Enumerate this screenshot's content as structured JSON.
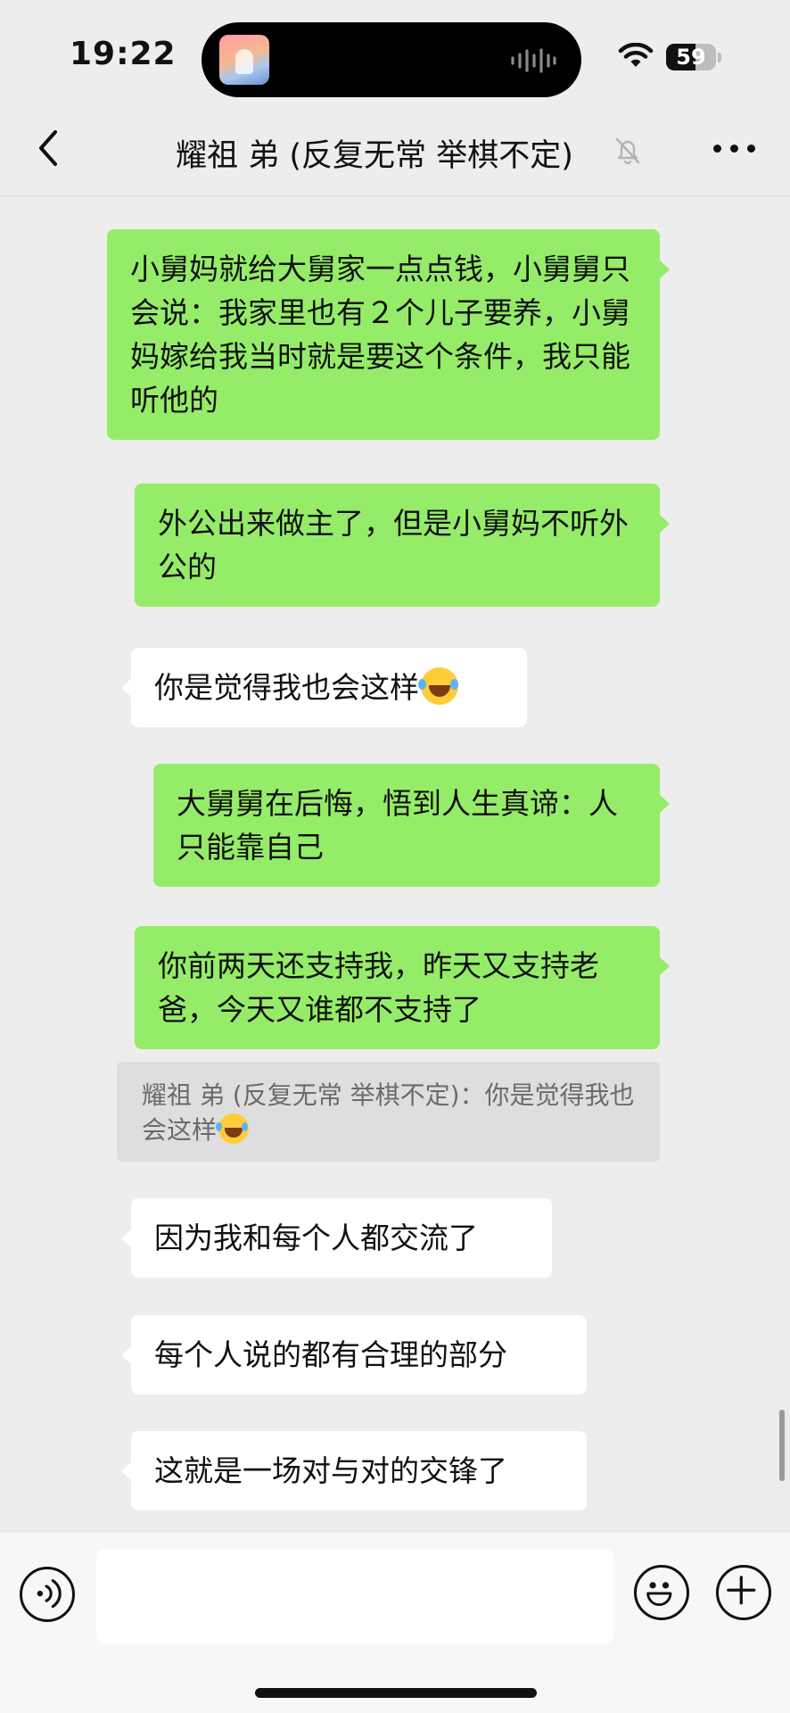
{
  "status_bar": {
    "time": "19:22",
    "battery_level": "59",
    "battery_fraction": 0.59,
    "island_art": "album-artwork",
    "island_activity": "audio-waveform-icon",
    "wifi": "wifi-icon"
  },
  "nav": {
    "title": "耀祖 弟 (反复无常 举棋不定)",
    "back_icon": "chevron-left-icon",
    "mute_icon": "bell-slash-icon",
    "more_icon": "more-dots-icon"
  },
  "messages": [
    {
      "sender": "me",
      "text": "小舅妈就给大舅家一点点钱，小舅舅只会说：我家里也有２个儿子要养，小舅妈嫁给我当时就是要这个条件，我只能听他的"
    },
    {
      "sender": "me",
      "text": "外公出来做主了，但是小舅妈不听外公的"
    },
    {
      "sender": "other",
      "text": "你是觉得我也会这样",
      "emoji": "tears-of-joy-emoji"
    },
    {
      "sender": "me",
      "text": "大舅舅在后悔，悟到人生真谛：人只能靠自己"
    },
    {
      "sender": "me",
      "text": "你前两天还支持我，昨天又支持老爸，今天又谁都不支持了"
    },
    {
      "sender": "other",
      "text": "因为我和每个人都交流了"
    },
    {
      "sender": "other",
      "text": "每个人说的都有合理的部分"
    },
    {
      "sender": "other",
      "text": "这就是一场对与对的交锋了"
    }
  ],
  "quote": {
    "text": "耀祖 弟 (反复无常 举棋不定)：你是觉得我也会这样",
    "emoji": "tears-of-joy-emoji"
  },
  "input_bar": {
    "voice_icon": "voice-icon",
    "input_value": "",
    "emoji_icon": "smiley-icon",
    "plus_icon": "plus-circle-icon"
  },
  "colors": {
    "background": "#ededed",
    "my_bubble": "#95ec69",
    "other_bubble": "#ffffff",
    "quote_bg": "#dedede"
  }
}
